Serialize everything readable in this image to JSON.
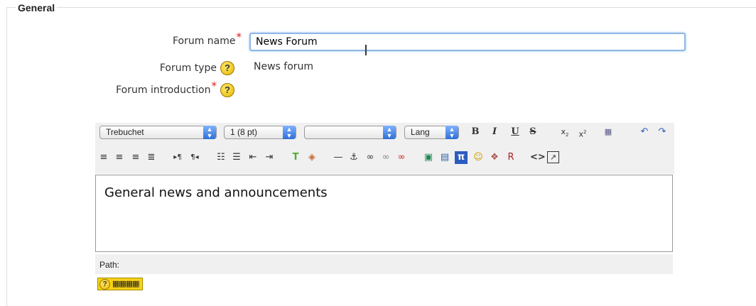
{
  "section": {
    "legend": "General"
  },
  "form": {
    "forum_name_label": "Forum name",
    "forum_name_value": "News Forum",
    "forum_type_label": "Forum type",
    "forum_type_value": "News forum",
    "forum_intro_label": "Forum introduction",
    "required_mark": "*",
    "help_glyph": "?"
  },
  "editor": {
    "font_family": "Trebuchet",
    "font_size": "1 (8 pt)",
    "heading": "",
    "lang": "Lang",
    "content": "General news and announcements",
    "path_label": "Path:"
  },
  "toolbar_icons": {
    "row1": [
      "bold-icon",
      "italic-icon",
      "underline-icon",
      "strikethrough-icon",
      "subscript-icon",
      "superscript-icon",
      "paste-word-icon",
      "undo-icon",
      "redo-icon"
    ],
    "row2": [
      "align-left-icon",
      "align-center-icon",
      "align-right-icon",
      "align-justify-icon",
      "ltr-icon",
      "rtl-icon",
      "ordered-list-icon",
      "unordered-list-icon",
      "outdent-icon",
      "indent-icon",
      "text-color-icon",
      "background-color-icon",
      "horizontal-rule-icon",
      "anchor-icon",
      "link-icon",
      "unlink-icon",
      "nolink-icon",
      "image-icon",
      "table-icon",
      "math-icon",
      "smiley-icon",
      "special-char-icon",
      "search-replace-icon",
      "html-source-icon",
      "fullscreen-icon"
    ]
  },
  "colors": {
    "required": "#dd2222",
    "help_bg": "#f0c800",
    "focus_border": "#8fb7e6",
    "toolbar_bg": "#f0f0f0"
  }
}
